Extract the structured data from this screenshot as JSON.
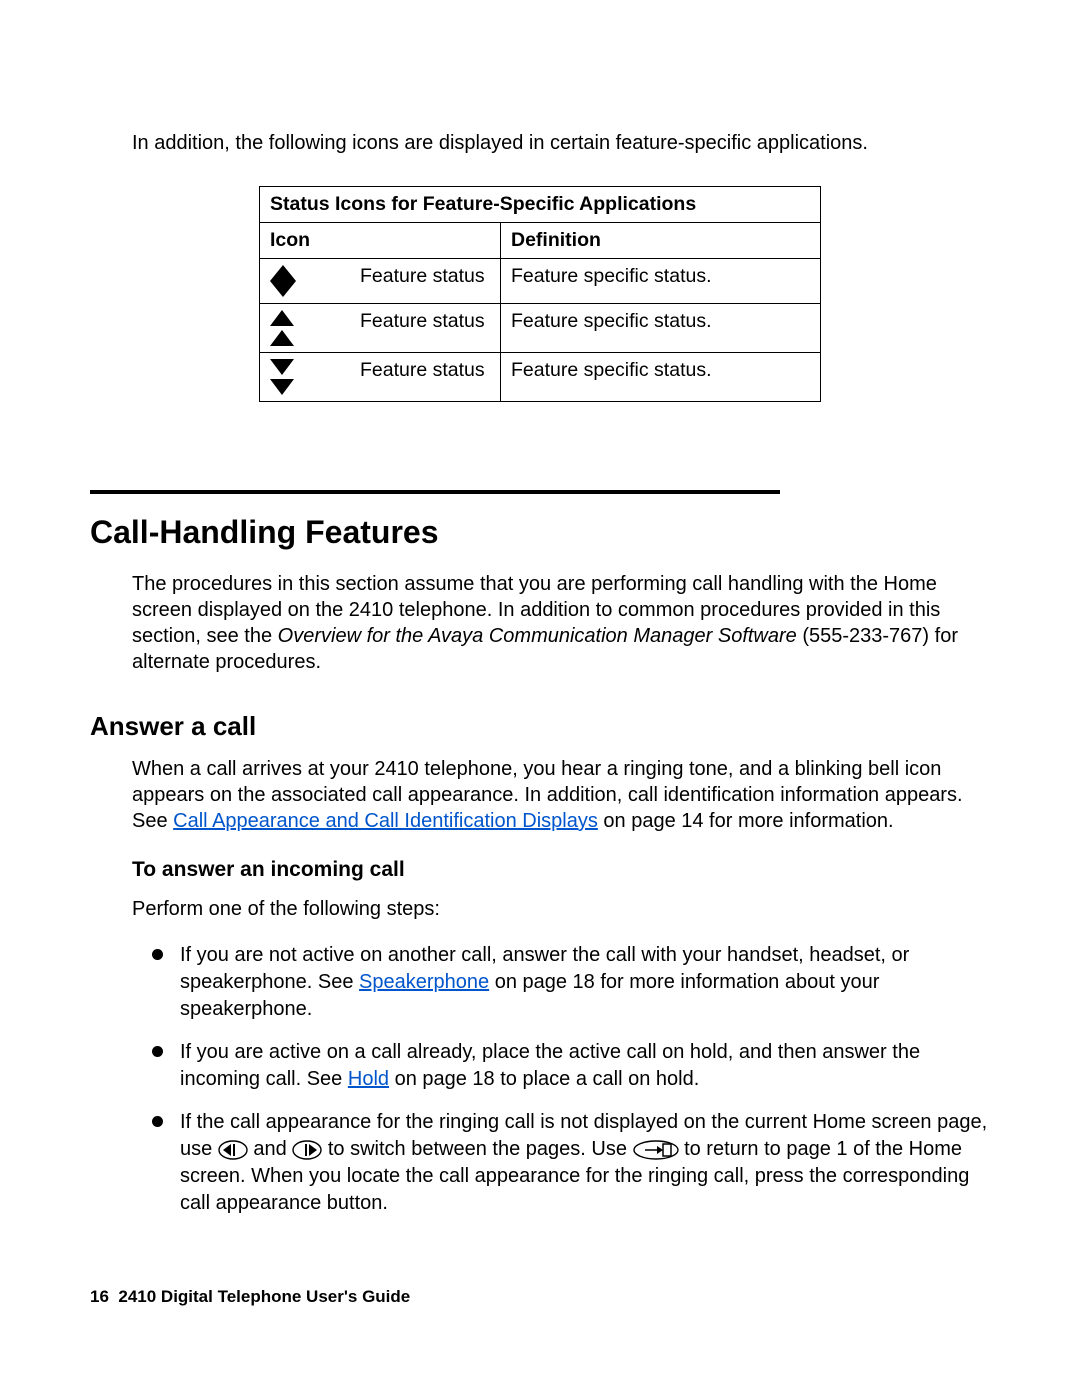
{
  "intro": "In addition, the following icons are displayed in certain feature-specific applications.",
  "table": {
    "title": "Status Icons for Feature-Specific Applications",
    "headers": {
      "icon": "Icon",
      "definition": "Definition"
    },
    "rows": [
      {
        "icon_name": "diamond-icon",
        "label": "Feature status",
        "definition": "Feature specific status."
      },
      {
        "icon_name": "double-up-triangle-icon",
        "label": "Feature status",
        "definition": "Feature specific status."
      },
      {
        "icon_name": "double-down-triangle-icon",
        "label": "Feature status",
        "definition": "Feature specific status."
      }
    ]
  },
  "section": {
    "heading": "Call-Handling Features",
    "para_a": "The procedures in this section assume that you are performing call handling with the Home screen displayed on the 2410 telephone. In addition to common procedures provided in this section, see the ",
    "para_italic": "Overview for the Avaya Communication Manager Software",
    "para_b": " (555-233-767) for alternate procedures."
  },
  "answer": {
    "heading": "Answer a call",
    "para_a": "When a call arrives at your 2410 telephone, you hear a ringing tone, and a blinking bell icon appears on the associated call appearance. In addition, call identification information appears. See ",
    "link": "Call Appearance and Call Identification Displays",
    "para_b": " on page 14 for more information."
  },
  "incoming": {
    "heading": "To answer an incoming call",
    "lead": "Perform one of the following steps:",
    "bullets": [
      {
        "a": "If you are not active on another call, answer the call with your handset, headset, or speakerphone. See ",
        "link": "Speakerphone",
        "b": " on page 18 for more information about your speakerphone."
      },
      {
        "a": "If you are active on a call already, place the active call on hold, and then answer the incoming call. See ",
        "link": "Hold",
        "b": " on page 18 to place a call on hold."
      },
      {
        "a": "If the call appearance for the ringing call is not displayed on the current Home screen page, use ",
        "mid1": " and ",
        "mid2": " to switch between the pages. Use ",
        "b": " to return to page 1 of the Home screen. When you locate the call appearance for the ringing call, press the corresponding call appearance button."
      }
    ]
  },
  "footer": {
    "page": "16",
    "title": "2410 Digital Telephone User's Guide"
  }
}
